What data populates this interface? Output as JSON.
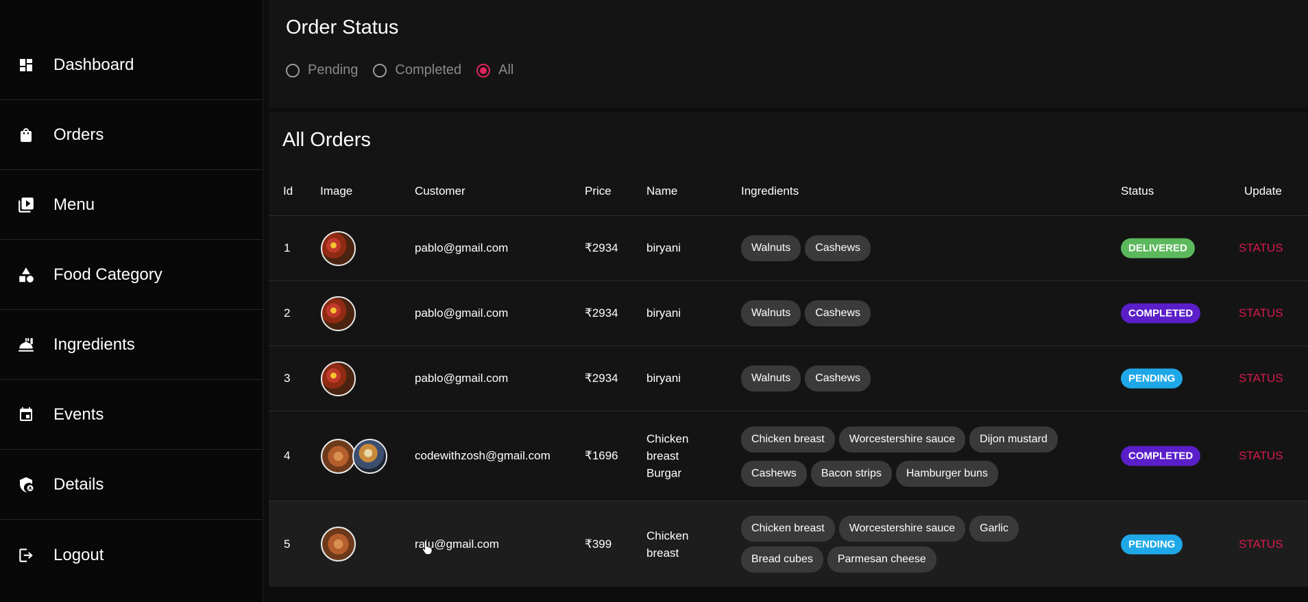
{
  "sidebar": {
    "items": [
      {
        "label": "Dashboard",
        "icon": "dashboard-icon"
      },
      {
        "label": "Orders",
        "icon": "shopping-bag-icon"
      },
      {
        "label": "Menu",
        "icon": "video-library-icon"
      },
      {
        "label": "Food Category",
        "icon": "category-icon"
      },
      {
        "label": "Ingredients",
        "icon": "food-bank-icon"
      },
      {
        "label": "Events",
        "icon": "event-icon"
      },
      {
        "label": "Details",
        "icon": "admin-panel-icon"
      },
      {
        "label": "Logout",
        "icon": "logout-icon"
      }
    ]
  },
  "order_status": {
    "title": "Order Status",
    "options": [
      {
        "label": "Pending",
        "checked": false
      },
      {
        "label": "Completed",
        "checked": false
      },
      {
        "label": "All",
        "checked": true
      }
    ]
  },
  "orders": {
    "title": "All Orders",
    "columns": [
      "Id",
      "Image",
      "Customer",
      "Price",
      "Name",
      "Ingredients",
      "Status",
      "Update"
    ],
    "rows": [
      {
        "id": "1",
        "customer": "pablo@gmail.com",
        "price": "₹2934",
        "name": "biryani",
        "ingredients": [
          "Walnuts",
          "Cashews"
        ],
        "status": "DELIVERED",
        "update": "STATUS"
      },
      {
        "id": "2",
        "customer": "pablo@gmail.com",
        "price": "₹2934",
        "name": "biryani",
        "ingredients": [
          "Walnuts",
          "Cashews"
        ],
        "status": "COMPLETED",
        "update": "STATUS"
      },
      {
        "id": "3",
        "customer": "pablo@gmail.com",
        "price": "₹2934",
        "name": "biryani",
        "ingredients": [
          "Walnuts",
          "Cashews"
        ],
        "status": "PENDING",
        "update": "STATUS"
      },
      {
        "id": "4",
        "customer": "codewithzosh@gmail.com",
        "price": "₹1696",
        "name": "Chicken breast Burgar",
        "ingredients": [
          "Chicken breast",
          "Worcestershire sauce",
          "Dijon mustard",
          "Cashews",
          "Bacon strips",
          "Hamburger buns"
        ],
        "status": "COMPLETED",
        "update": "STATUS"
      },
      {
        "id": "5",
        "customer": "ralu@gmail.com",
        "price": "₹399",
        "name": "Chicken breast",
        "ingredients": [
          "Chicken breast",
          "Worcestershire sauce",
          "Garlic",
          "Bread cubes",
          "Parmesan cheese"
        ],
        "status": "PENDING",
        "update": "STATUS"
      }
    ]
  },
  "colors": {
    "accent": "#e0245e",
    "delivered": "#5cb85c",
    "completed": "#5a1fc9",
    "pending": "#1fa8e8",
    "update_link": "#d81b4e"
  }
}
